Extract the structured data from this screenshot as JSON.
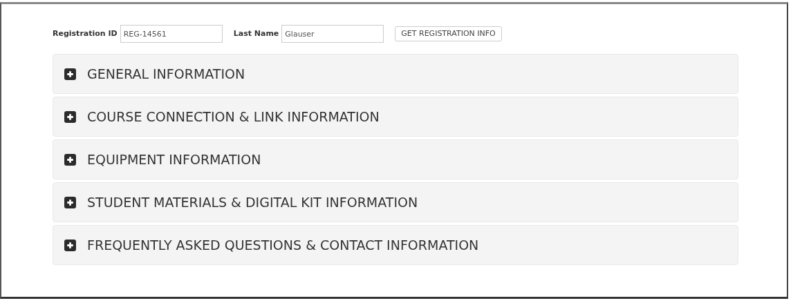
{
  "form": {
    "fields": [
      {
        "label": "Registration ID",
        "value": "REG-14561"
      },
      {
        "label": "Last Name",
        "value": "Glauser"
      }
    ],
    "button": "GET REGISTRATION INFO"
  },
  "sections": [
    {
      "title": "GENERAL INFORMATION",
      "expanded": false
    },
    {
      "title": "COURSE CONNECTION & LINK INFORMATION",
      "expanded": false
    },
    {
      "title": "EQUIPMENT INFORMATION",
      "expanded": false
    },
    {
      "title": "STUDENT MATERIALS & DIGITAL KIT INFORMATION",
      "expanded": false
    },
    {
      "title": "FREQUENTLY ASKED QUESTIONS & CONTACT INFORMATION",
      "expanded": false
    }
  ]
}
